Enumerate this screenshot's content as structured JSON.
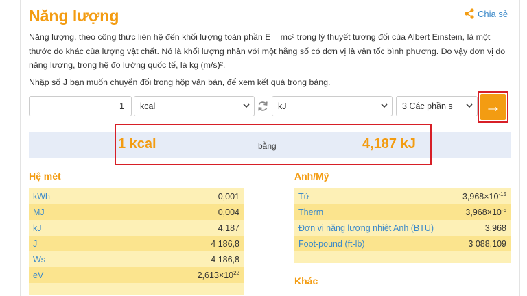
{
  "page": {
    "title": "Năng lượng",
    "share_label": "Chia sẻ",
    "description": "Năng lượng, theo công thức liên hệ đến khối lượng toàn phần E = mc² trong lý thuyết tương đối của Albert Einstein, là một thước đo khác của lượng vật chất. Nó là khối lượng nhân với một hằng số có đơn vị là vận tốc bình phương. Do vậy đơn vị đo năng lượng, trong hệ đo lường quốc tế, là kg (m/s)².",
    "instruction_before": "Nhập số ",
    "instruction_bold": "J",
    "instruction_after": " bạn muốn chuyển đổi trong hộp văn bản, để xem kết quả trong bảng."
  },
  "converter": {
    "input_value": "1",
    "from_unit": "kcal",
    "to_unit": "kJ",
    "precision": "3 Các phần s",
    "go_symbol": "→"
  },
  "result": {
    "left": "1 kcal",
    "middle": "bằng",
    "right": "4,187 kJ"
  },
  "metric": {
    "title": "Hệ mét",
    "rows": [
      {
        "unit": "kWh",
        "value": "0,001"
      },
      {
        "unit": "MJ",
        "value": "0,004"
      },
      {
        "unit": "kJ",
        "value": "4,187"
      },
      {
        "unit": "J",
        "value": "4 186,8"
      },
      {
        "unit": "Ws",
        "value": "4 186,8"
      },
      {
        "unit": "eV",
        "value": "2,613×10",
        "exp": "22"
      }
    ]
  },
  "imperial": {
    "title": "Anh/Mỹ",
    "rows": [
      {
        "unit": "Tứ",
        "value": "3,968×10",
        "exp": "-15"
      },
      {
        "unit": "Therm",
        "value": "3,968×10",
        "exp": "-5"
      },
      {
        "unit": "Đơn vị năng lượng nhiệt Anh (BTU)",
        "value": "3,968"
      },
      {
        "unit": "Foot-pound (ft-lb)",
        "value": "3 088,109"
      }
    ]
  },
  "other": {
    "title": "Khác"
  },
  "colors": {
    "accent": "#f39c12",
    "highlight_outline": "#d71f27",
    "link": "#3b89c9"
  }
}
